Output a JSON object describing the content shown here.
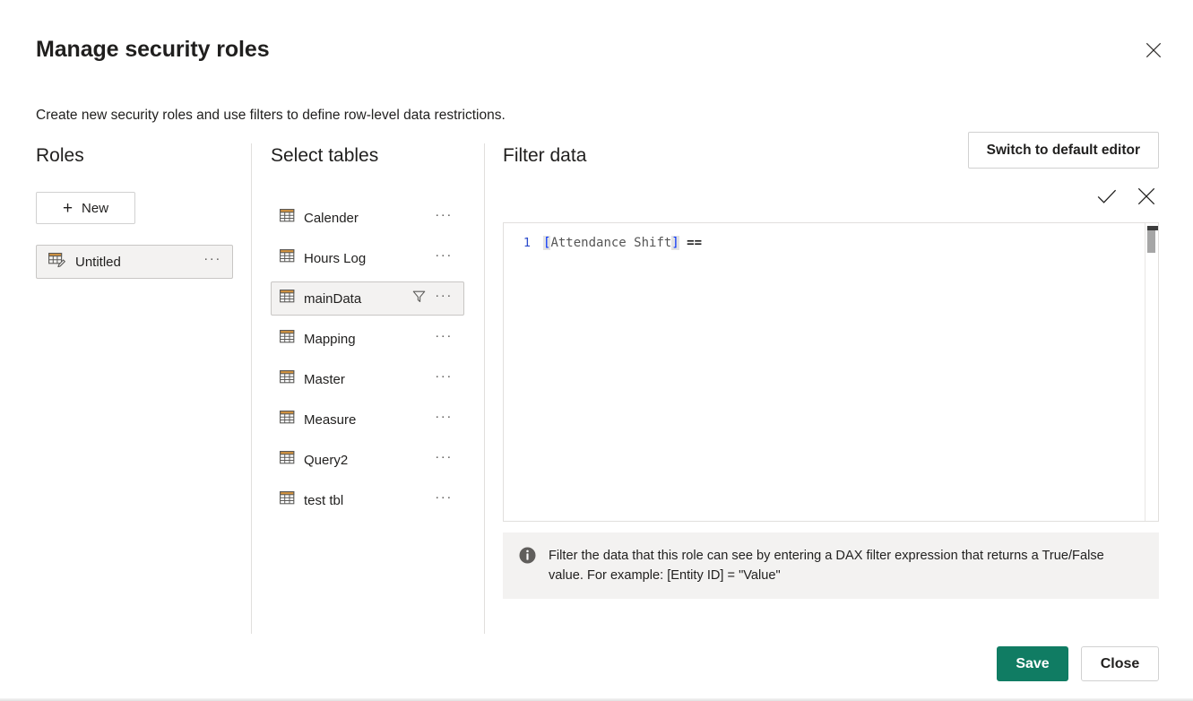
{
  "dialog": {
    "title": "Manage security roles",
    "subtitle": "Create new security roles and use filters to define row-level data restrictions.",
    "close_icon": "close-icon"
  },
  "roles": {
    "heading": "Roles",
    "new_button": "New",
    "new_icon": "plus-icon",
    "items": [
      {
        "label": "Untitled",
        "icon": "table-edit-icon",
        "overflow": "···",
        "selected": true
      }
    ]
  },
  "tables": {
    "heading": "Select tables",
    "overflow": "···",
    "items": [
      {
        "label": "Calender",
        "icon": "table-icon",
        "selected": false,
        "has_filter": false
      },
      {
        "label": "Hours Log",
        "icon": "table-icon",
        "selected": false,
        "has_filter": false
      },
      {
        "label": "mainData",
        "icon": "table-icon",
        "selected": true,
        "has_filter": true
      },
      {
        "label": "Mapping",
        "icon": "table-icon",
        "selected": false,
        "has_filter": false
      },
      {
        "label": "Master",
        "icon": "table-icon",
        "selected": false,
        "has_filter": false
      },
      {
        "label": "Measure",
        "icon": "table-icon",
        "selected": false,
        "has_filter": false
      },
      {
        "label": "Query2",
        "icon": "table-icon",
        "selected": false,
        "has_filter": false
      },
      {
        "label": "test tbl",
        "icon": "table-icon",
        "selected": false,
        "has_filter": false
      }
    ]
  },
  "filter": {
    "heading": "Filter data",
    "switch_button": "Switch to default editor",
    "accept_icon": "checkmark-icon",
    "cancel_icon": "close-icon",
    "editor": {
      "line_number": "1",
      "open_bracket": "[",
      "identifier": "Attendance Shift",
      "close_bracket": "]",
      "operator": " ==",
      "full_text": "[Attendance Shift] =="
    },
    "info": {
      "icon": "info-icon",
      "text": "Filter the data that this role can see by entering a DAX filter expression that returns a True/False value. For example: [Entity ID] = \"Value\""
    }
  },
  "footer": {
    "save_label": "Save",
    "close_label": "Close"
  },
  "colors": {
    "save_green": "#107c63",
    "selected_bg": "#f3f2f1",
    "border": "#d1d1d1",
    "divider": "#e1dfdd",
    "code_bracket": "#0431fa",
    "line_number": "#2b4acb"
  }
}
